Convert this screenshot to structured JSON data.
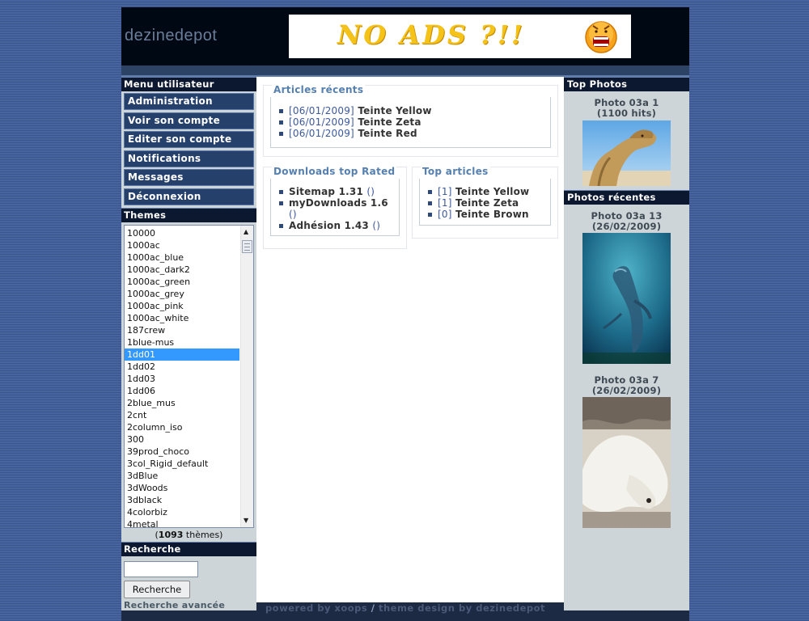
{
  "header": {
    "logo": "dezinedepot",
    "banner_text": "NO ADS ?!!"
  },
  "user_menu": {
    "title": "Menu utilisateur",
    "items": [
      "Administration",
      "Voir son compte",
      "Editer son compte",
      "Notifications",
      "Messages",
      "Déconnexion"
    ]
  },
  "themes": {
    "title": "Themes",
    "items": [
      "10000",
      "1000ac",
      "1000ac_blue",
      "1000ac_dark2",
      "1000ac_green",
      "1000ac_grey",
      "1000ac_pink",
      "1000ac_white",
      "187crew",
      "1blue-mus",
      "1dd01",
      "1dd02",
      "1dd03",
      "1dd06",
      "2blue_mus",
      "2cnt",
      "2column_iso",
      "300",
      "39prod_choco",
      "3col_Rigid_default",
      "3dBlue",
      "3dWoods",
      "3dblack",
      "4colorbiz",
      "4metal"
    ],
    "selected": "1dd01",
    "count_number": "1093",
    "count_suffix": " thèmes)",
    "count_prefix": "("
  },
  "search": {
    "title": "Recherche",
    "input_value": "",
    "button_label": "Recherche",
    "advanced_label": "Recherche avancée"
  },
  "recent_articles": {
    "title": "Articles récents",
    "items": [
      {
        "date": "[06/01/2009]",
        "name": "Teinte Yellow"
      },
      {
        "date": "[06/01/2009]",
        "name": "Teinte Zeta"
      },
      {
        "date": "[06/01/2009]",
        "name": "Teinte Red"
      }
    ]
  },
  "downloads_top": {
    "title": "Downloads top Rated",
    "items": [
      {
        "name": "Sitemap 1.31",
        "link": "()"
      },
      {
        "name": "myDownloads 1.6",
        "link": "()"
      },
      {
        "name": "Adhésion 1.43",
        "link": "()"
      }
    ]
  },
  "top_articles": {
    "title": "Top articles",
    "items": [
      {
        "count": "[1]",
        "name": "Teinte Yellow"
      },
      {
        "count": "[1]",
        "name": "Teinte Zeta"
      },
      {
        "count": "[0]",
        "name": "Teinte Brown"
      }
    ]
  },
  "top_photos": {
    "title": "Top Photos",
    "items": [
      {
        "caption": "Photo 03a 1 (1100 hits)",
        "icon": "camel-photo"
      }
    ]
  },
  "recent_photos": {
    "title": "Photos récentes",
    "items": [
      {
        "caption": "Photo 03a 13 (26/02/2009)",
        "icon": "dolphin-photo"
      },
      {
        "caption": "Photo 03a 7 (26/02/2009)",
        "icon": "polar-bear-photo"
      }
    ]
  },
  "footer": {
    "powered": "powered by xoops",
    "separator": " / ",
    "design": "theme design by dezinedepot"
  },
  "colors": {
    "background": "#3d5a8e",
    "block_title": "#0c1730",
    "menu_item": "#26406c",
    "selection": "#3399ff",
    "link": "#3d5a9c",
    "box_title": "#5680b0"
  }
}
